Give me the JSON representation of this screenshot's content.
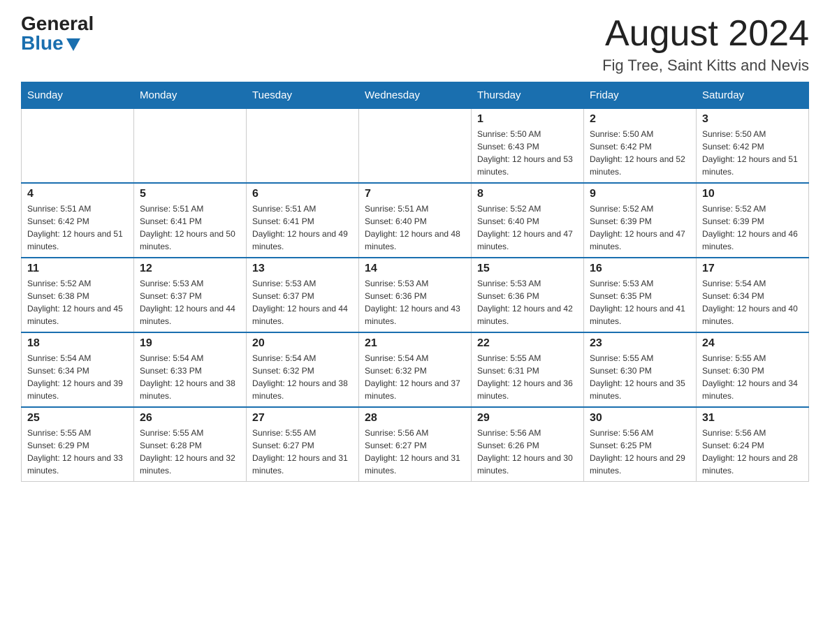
{
  "logo": {
    "general": "General",
    "blue": "Blue"
  },
  "header": {
    "month": "August 2024",
    "location": "Fig Tree, Saint Kitts and Nevis"
  },
  "weekdays": [
    "Sunday",
    "Monday",
    "Tuesday",
    "Wednesday",
    "Thursday",
    "Friday",
    "Saturday"
  ],
  "weeks": [
    [
      {
        "day": "",
        "info": ""
      },
      {
        "day": "",
        "info": ""
      },
      {
        "day": "",
        "info": ""
      },
      {
        "day": "",
        "info": ""
      },
      {
        "day": "1",
        "info": "Sunrise: 5:50 AM\nSunset: 6:43 PM\nDaylight: 12 hours and 53 minutes."
      },
      {
        "day": "2",
        "info": "Sunrise: 5:50 AM\nSunset: 6:42 PM\nDaylight: 12 hours and 52 minutes."
      },
      {
        "day": "3",
        "info": "Sunrise: 5:50 AM\nSunset: 6:42 PM\nDaylight: 12 hours and 51 minutes."
      }
    ],
    [
      {
        "day": "4",
        "info": "Sunrise: 5:51 AM\nSunset: 6:42 PM\nDaylight: 12 hours and 51 minutes."
      },
      {
        "day": "5",
        "info": "Sunrise: 5:51 AM\nSunset: 6:41 PM\nDaylight: 12 hours and 50 minutes."
      },
      {
        "day": "6",
        "info": "Sunrise: 5:51 AM\nSunset: 6:41 PM\nDaylight: 12 hours and 49 minutes."
      },
      {
        "day": "7",
        "info": "Sunrise: 5:51 AM\nSunset: 6:40 PM\nDaylight: 12 hours and 48 minutes."
      },
      {
        "day": "8",
        "info": "Sunrise: 5:52 AM\nSunset: 6:40 PM\nDaylight: 12 hours and 47 minutes."
      },
      {
        "day": "9",
        "info": "Sunrise: 5:52 AM\nSunset: 6:39 PM\nDaylight: 12 hours and 47 minutes."
      },
      {
        "day": "10",
        "info": "Sunrise: 5:52 AM\nSunset: 6:39 PM\nDaylight: 12 hours and 46 minutes."
      }
    ],
    [
      {
        "day": "11",
        "info": "Sunrise: 5:52 AM\nSunset: 6:38 PM\nDaylight: 12 hours and 45 minutes."
      },
      {
        "day": "12",
        "info": "Sunrise: 5:53 AM\nSunset: 6:37 PM\nDaylight: 12 hours and 44 minutes."
      },
      {
        "day": "13",
        "info": "Sunrise: 5:53 AM\nSunset: 6:37 PM\nDaylight: 12 hours and 44 minutes."
      },
      {
        "day": "14",
        "info": "Sunrise: 5:53 AM\nSunset: 6:36 PM\nDaylight: 12 hours and 43 minutes."
      },
      {
        "day": "15",
        "info": "Sunrise: 5:53 AM\nSunset: 6:36 PM\nDaylight: 12 hours and 42 minutes."
      },
      {
        "day": "16",
        "info": "Sunrise: 5:53 AM\nSunset: 6:35 PM\nDaylight: 12 hours and 41 minutes."
      },
      {
        "day": "17",
        "info": "Sunrise: 5:54 AM\nSunset: 6:34 PM\nDaylight: 12 hours and 40 minutes."
      }
    ],
    [
      {
        "day": "18",
        "info": "Sunrise: 5:54 AM\nSunset: 6:34 PM\nDaylight: 12 hours and 39 minutes."
      },
      {
        "day": "19",
        "info": "Sunrise: 5:54 AM\nSunset: 6:33 PM\nDaylight: 12 hours and 38 minutes."
      },
      {
        "day": "20",
        "info": "Sunrise: 5:54 AM\nSunset: 6:32 PM\nDaylight: 12 hours and 38 minutes."
      },
      {
        "day": "21",
        "info": "Sunrise: 5:54 AM\nSunset: 6:32 PM\nDaylight: 12 hours and 37 minutes."
      },
      {
        "day": "22",
        "info": "Sunrise: 5:55 AM\nSunset: 6:31 PM\nDaylight: 12 hours and 36 minutes."
      },
      {
        "day": "23",
        "info": "Sunrise: 5:55 AM\nSunset: 6:30 PM\nDaylight: 12 hours and 35 minutes."
      },
      {
        "day": "24",
        "info": "Sunrise: 5:55 AM\nSunset: 6:30 PM\nDaylight: 12 hours and 34 minutes."
      }
    ],
    [
      {
        "day": "25",
        "info": "Sunrise: 5:55 AM\nSunset: 6:29 PM\nDaylight: 12 hours and 33 minutes."
      },
      {
        "day": "26",
        "info": "Sunrise: 5:55 AM\nSunset: 6:28 PM\nDaylight: 12 hours and 32 minutes."
      },
      {
        "day": "27",
        "info": "Sunrise: 5:55 AM\nSunset: 6:27 PM\nDaylight: 12 hours and 31 minutes."
      },
      {
        "day": "28",
        "info": "Sunrise: 5:56 AM\nSunset: 6:27 PM\nDaylight: 12 hours and 31 minutes."
      },
      {
        "day": "29",
        "info": "Sunrise: 5:56 AM\nSunset: 6:26 PM\nDaylight: 12 hours and 30 minutes."
      },
      {
        "day": "30",
        "info": "Sunrise: 5:56 AM\nSunset: 6:25 PM\nDaylight: 12 hours and 29 minutes."
      },
      {
        "day": "31",
        "info": "Sunrise: 5:56 AM\nSunset: 6:24 PM\nDaylight: 12 hours and 28 minutes."
      }
    ]
  ]
}
